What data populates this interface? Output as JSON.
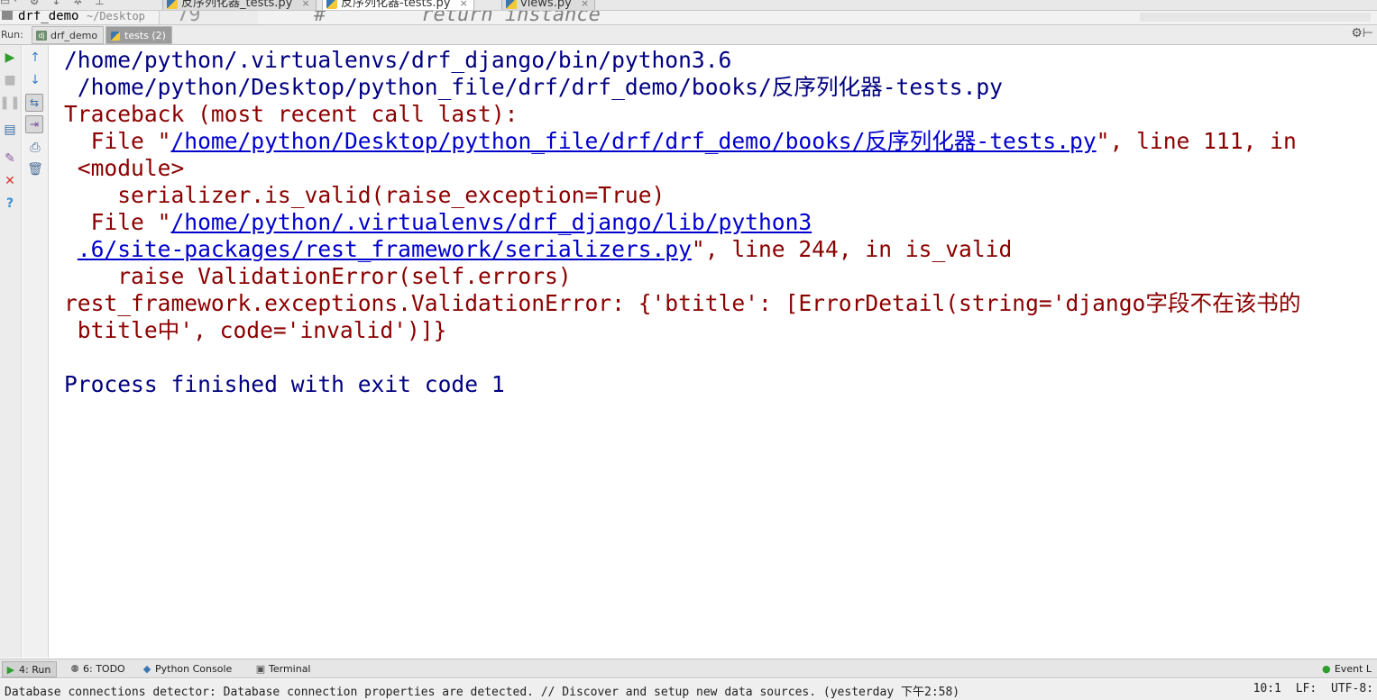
{
  "editor": {
    "toolbar_icons": [
      "gear-icon",
      "collapse-icon",
      "settings-icon",
      "pin-icon"
    ],
    "tabs": [
      {
        "label": "反序列化器_tests.py",
        "active": false
      },
      {
        "label": "反序列化器-tests.py",
        "active": true
      },
      {
        "label": "views.py",
        "active": false
      }
    ],
    "close_glyph": "×",
    "project_name": "drf_demo",
    "project_path": "~/Desktop",
    "visible_line_number": "79",
    "visible_code": "#        return instance"
  },
  "run_window": {
    "label": "Run:",
    "tabs": [
      {
        "label": "drf_demo",
        "active": false
      },
      {
        "label": "tests (2)",
        "active": true
      }
    ]
  },
  "console": {
    "lines": [
      {
        "text": "/home/python/.virtualenvs/drf_django/bin/python3.6",
        "style": "blue"
      },
      {
        "text": " /home/python/Desktop/python_file/drf/drf_demo/books/反序列化器-tests.py",
        "style": "blue"
      },
      {
        "text": "Traceback (most recent call last):",
        "style": "red"
      },
      {
        "prefix": "  File \"",
        "link": "/home/python/Desktop/python_file/drf/drf_demo/books/反序列化器-tests.py",
        "suffix": "\", line 111, in"
      },
      {
        "text": " <module>",
        "style": "red"
      },
      {
        "text": "    serializer.is_valid(raise_exception=True)",
        "style": "red"
      },
      {
        "prefix": "  File \"",
        "link": "/home/python/.virtualenvs/drf_django/lib/python3",
        "suffix": ""
      },
      {
        "prefix": " ",
        "link": ".6/site-packages/rest_framework/serializers.py",
        "suffix": "\", line 244, in is_valid"
      },
      {
        "text": "    raise ValidationError(self.errors)",
        "style": "red"
      },
      {
        "text": "rest_framework.exceptions.ValidationError: {'btitle': [ErrorDetail(string='django字段不在该书的",
        "style": "red"
      },
      {
        "text": " btitle中', code='invalid')]}",
        "style": "red"
      },
      {
        "text": "",
        "style": "blue"
      },
      {
        "text": "Process finished with exit code 1",
        "style": "blue"
      }
    ]
  },
  "bottom_tabs": [
    {
      "label": "4: Run",
      "icon": "run-icon",
      "active": true
    },
    {
      "label": "6: TODO",
      "icon": "todo-icon",
      "active": false
    },
    {
      "label": "Python Console",
      "icon": "python-console-icon",
      "active": false
    },
    {
      "label": "Terminal",
      "icon": "terminal-icon",
      "active": false
    }
  ],
  "event_log": {
    "label": "Event L",
    "icon": "event-log-icon"
  },
  "status": {
    "message": "Database connections detector: Database connection properties are detected. // Discover and setup new data sources. (yesterday 下午2:58)",
    "position": "10:1",
    "line_sep": "LF:",
    "encoding": "UTF-8:"
  }
}
